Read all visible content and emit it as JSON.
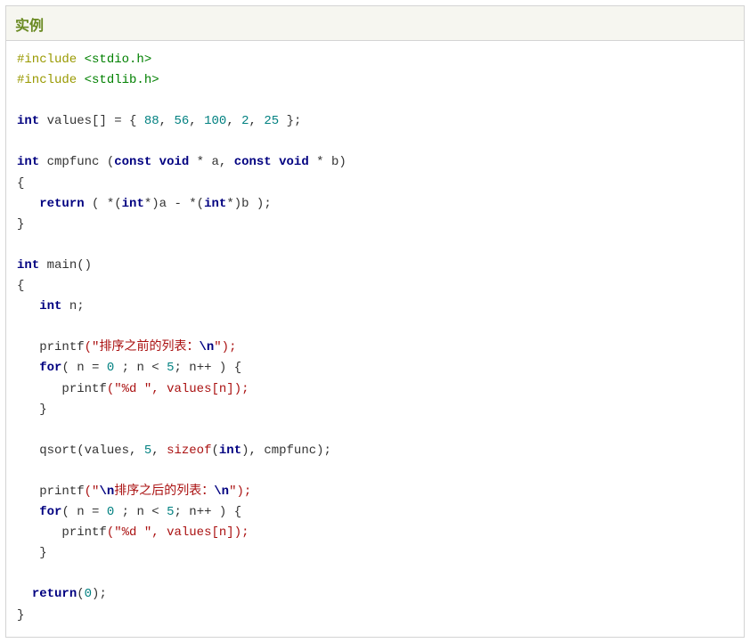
{
  "header": {
    "title": "实例"
  },
  "code": {
    "inc1_pp": "#include",
    "inc1_hdr": "<stdio.h>",
    "inc2_pp": "#include",
    "inc2_hdr": "<stdlib.h>",
    "kw_int": "int",
    "kw_void": "void",
    "kw_const": "const",
    "kw_return": "return",
    "kw_for": "for",
    "id_values": "values",
    "arr_open": "[] = { ",
    "n88": "88",
    "n56": "56",
    "n100": "100",
    "n2": "2",
    "n25": "25",
    "arr_close": " };",
    "comma_sp": ", ",
    "id_cmpfunc": "cmpfunc",
    "cmp_params_1": " (",
    "cmp_star_a": " * a, ",
    "cmp_star_b": " * b)",
    "lbrace": "{",
    "rbrace": "}",
    "cmp_body_pre": "   ",
    "cmp_ret_expr": " ( *(",
    "cmp_cast_int": "int",
    "cmp_ret_mid1": "*)a - *(",
    "cmp_ret_mid2": "*)b );",
    "id_main": "main",
    "main_parens": "()",
    "decl_n_pre": "   ",
    "decl_n_post": " n;",
    "printf": "printf",
    "pf1_open": "(\"",
    "pf1_text": "排序之前的列表：",
    "esc_n": "\\n",
    "pf_close": "\");",
    "indent3": "   ",
    "indent6": "      ",
    "for_open": "( n = ",
    "n0": "0",
    "for_mid": " ; n < ",
    "n5": "5",
    "for_end": "; n++ ) {",
    "pf_item_open": "(\"",
    "pf_item_fmt": "%d ",
    "pf_item_close": "\", values[n]);",
    "qsort": "qsort",
    "qs_open": "(values, ",
    "qs_comma_sp": ", ",
    "sizeof": "sizeof",
    "qs_int_open": "(",
    "qs_int_close": "), cmpfunc);",
    "pf3_text": "排序之后的列表：",
    "ret0_open": "(",
    "ret0_close": ");",
    "sp": " "
  }
}
